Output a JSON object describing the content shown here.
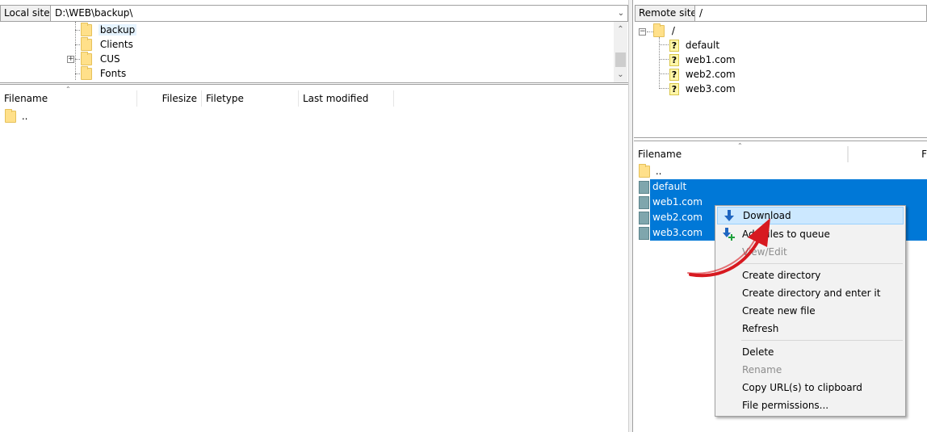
{
  "local": {
    "site_label": "Local site:",
    "path": "D:\\WEB\\backup\\",
    "tree": [
      "backup",
      "Clients",
      "CUS",
      "Fonts"
    ],
    "columns": [
      "Filename",
      "Filesize",
      "Filetype",
      "Last modified"
    ],
    "files": [
      ".."
    ]
  },
  "remote": {
    "site_label": "Remote site:",
    "path": "/",
    "tree_root": "/",
    "tree": [
      "default",
      "web1.com",
      "web2.com",
      "web3.com"
    ],
    "columns": [
      "Filename",
      "F"
    ],
    "files": [
      "..",
      "default",
      "web1.com",
      "web2.com",
      "web3.com"
    ]
  },
  "context_menu": {
    "items": [
      {
        "label": "Download",
        "icon": "download-arrow-icon",
        "highlighted": true
      },
      {
        "label": "Add files to queue",
        "icon": "add-to-queue-icon"
      },
      {
        "label": "View/Edit",
        "disabled": true
      },
      {
        "label": "Create directory"
      },
      {
        "label": "Create directory and enter it"
      },
      {
        "label": "Create new file"
      },
      {
        "label": "Refresh"
      },
      {
        "label": "Delete"
      },
      {
        "label": "Rename",
        "disabled": true
      },
      {
        "label": "Copy URL(s) to clipboard"
      },
      {
        "label": "File permissions..."
      }
    ]
  },
  "annotation": {
    "icon": "red-curved-arrow-icon",
    "color": "#d71920"
  },
  "colors": {
    "selection": "#0078d7",
    "menu_highlight": "#cce8ff",
    "folder": "#ffe08a"
  }
}
